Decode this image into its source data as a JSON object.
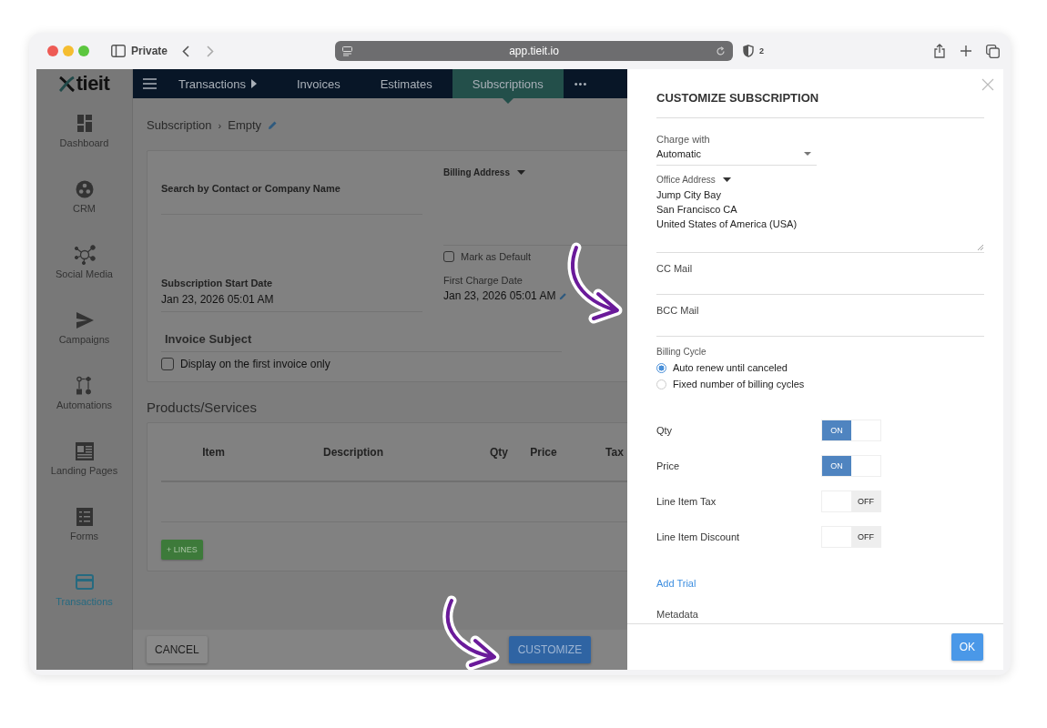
{
  "browser": {
    "private_label": "Private",
    "url": "app.tieit.io",
    "shield_count": "2"
  },
  "logo": {
    "text": "tieit"
  },
  "sidebar": {
    "items": [
      {
        "label": "Dashboard",
        "kind": "dashboard",
        "selected": false
      },
      {
        "label": "CRM",
        "kind": "crm",
        "selected": false
      },
      {
        "label": "Social Media",
        "kind": "social",
        "selected": false
      },
      {
        "label": "Campaigns",
        "kind": "send",
        "selected": false
      },
      {
        "label": "Automations",
        "kind": "flow",
        "selected": false
      },
      {
        "label": "Landing Pages",
        "kind": "page",
        "selected": false
      },
      {
        "label": "Forms",
        "kind": "form",
        "selected": false
      },
      {
        "label": "Transactions",
        "kind": "card",
        "selected": true
      }
    ]
  },
  "nav": {
    "tabs": [
      {
        "label": "Transactions",
        "submenu": true,
        "selected": false
      },
      {
        "label": "Invoices",
        "submenu": false,
        "selected": false
      },
      {
        "label": "Estimates",
        "submenu": false,
        "selected": false
      },
      {
        "label": "Subscriptions",
        "submenu": false,
        "selected": true
      }
    ],
    "more": "•••"
  },
  "breadcrumb": {
    "items": [
      "Subscription",
      "Empty"
    ],
    "separator": "›"
  },
  "form": {
    "search_label": "Search by Contact or Company Name",
    "billing_address": "Billing Address",
    "mark_default": {
      "label": "Mark as Default",
      "checked": false
    },
    "start_date": {
      "label": "Subscription Start Date",
      "value": "Jan 23, 2026 05:01 AM"
    },
    "first_charge": {
      "label": "First Charge Date",
      "value": "Jan 23, 2026 05:01 AM"
    },
    "invoice_subject": "Invoice Subject",
    "first_invoice_only": {
      "label": "Display on the first invoice only",
      "checked": false
    }
  },
  "products": {
    "title": "Products/Services",
    "columns": [
      "Item",
      "Description",
      "Qty",
      "Price",
      "Tax"
    ],
    "add_lines": "+ LINES"
  },
  "footer": {
    "cancel": "CANCEL",
    "customize": "CUSTOMIZE"
  },
  "panel": {
    "title": "CUSTOMIZE SUBSCRIPTION",
    "charge_with": {
      "label": "Charge with",
      "value": "Automatic"
    },
    "office_address": {
      "label": "Office Address",
      "lines": [
        "Jump City Bay",
        "San Francisco CA",
        "United States of America (USA)"
      ]
    },
    "cc_mail": {
      "label": "CC Mail"
    },
    "bcc_mail": {
      "label": "BCC Mail"
    },
    "billing_cycle": {
      "label": "Billing Cycle",
      "options": [
        {
          "label": "Auto renew until canceled",
          "selected": true
        },
        {
          "label": "Fixed number of billing cycles",
          "selected": false
        }
      ]
    },
    "toggles": [
      {
        "label": "Qty",
        "on": true,
        "text": "ON"
      },
      {
        "label": "Price",
        "on": true,
        "text": "ON"
      },
      {
        "label": "Line Item Tax",
        "on": false,
        "text": "OFF"
      },
      {
        "label": "Line Item Discount",
        "on": false,
        "text": "OFF"
      }
    ],
    "add_trial": "Add Trial",
    "metadata": "Metadata",
    "ok": "OK"
  }
}
